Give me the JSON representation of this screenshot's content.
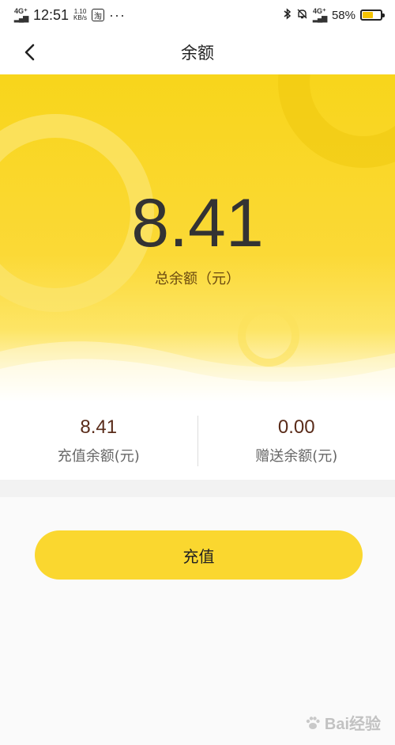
{
  "status_bar": {
    "network_left": "4G⁺",
    "time": "12:51",
    "speed_value": "1.10",
    "speed_unit": "KB/s",
    "app_glyph": "淘",
    "more": "···",
    "network_right": "4G⁺",
    "battery_percent": "58%",
    "battery_level": 0.58,
    "icons": [
      "signal-icon",
      "bluetooth-icon",
      "mute-icon",
      "battery-icon"
    ]
  },
  "nav": {
    "title": "余额",
    "back_icon": "chevron-left-icon"
  },
  "hero": {
    "total_amount": "8.41",
    "total_label": "总余额（元）"
  },
  "balances": [
    {
      "value": "8.41",
      "label": "充值余额(元)"
    },
    {
      "value": "0.00",
      "label": "赠送余额(元)"
    }
  ],
  "actions": {
    "recharge_label": "充值"
  },
  "watermark": {
    "text": "Bai经验"
  },
  "colors": {
    "accent": "#fad72f",
    "hero_top": "#f8d51b",
    "amount_text": "#333333",
    "sub_value_text": "#5a2c1a"
  }
}
